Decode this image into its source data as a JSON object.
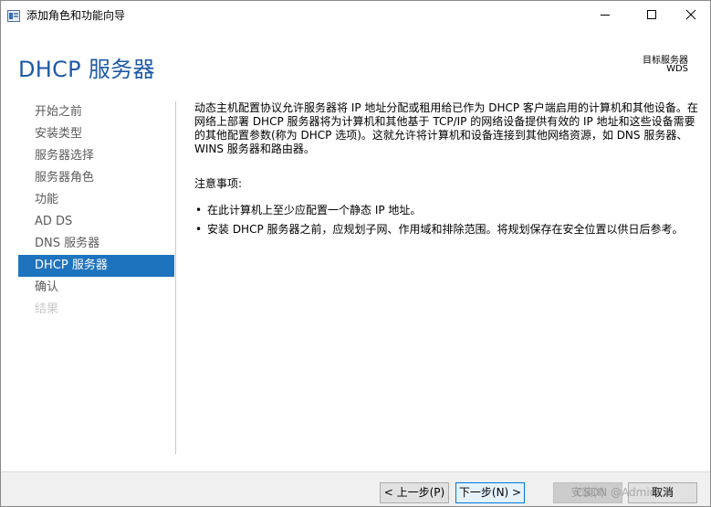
{
  "window": {
    "title": "添加角色和功能向导",
    "controls": {
      "minimize": "minimize-icon",
      "maximize": "maximize-icon",
      "close": "close-icon"
    }
  },
  "header": {
    "title": "DHCP 服务器",
    "target_label": "目标服务器",
    "target_value": "WDS"
  },
  "nav": {
    "items": [
      {
        "label": "开始之前",
        "state": "normal"
      },
      {
        "label": "安装类型",
        "state": "normal"
      },
      {
        "label": "服务器选择",
        "state": "normal"
      },
      {
        "label": "服务器角色",
        "state": "normal"
      },
      {
        "label": "功能",
        "state": "normal"
      },
      {
        "label": "AD DS",
        "state": "normal"
      },
      {
        "label": "DNS 服务器",
        "state": "normal"
      },
      {
        "label": "DHCP 服务器",
        "state": "active"
      },
      {
        "label": "确认",
        "state": "normal"
      },
      {
        "label": "结果",
        "state": "disabled"
      }
    ]
  },
  "content": {
    "description": "动态主机配置协议允许服务器将 IP 地址分配或租用给已作为 DHCP 客户端启用的计算机和其他设备。在网络上部署 DHCP 服务器将为计算机和其他基于 TCP/IP 的网络设备提供有效的 IP 地址和这些设备需要的其他配置参数(称为 DHCP 选项)。这就允许将计算机和设备连接到其他网络资源，如 DNS 服务器、WINS 服务器和路由器。",
    "notes_title": "注意事项:",
    "bullets": [
      "在此计算机上至少应配置一个静态 IP 地址。",
      "安装 DHCP 服务器之前，应规划子网、作用域和排除范围。将规划保存在安全位置以供日后参考。"
    ],
    "bullet_char": "•"
  },
  "footer": {
    "prev": "< 上一步(P)",
    "next": "下一步(N) >",
    "install": "安装(I)",
    "cancel": "取消"
  },
  "watermark": "CSDN @AdminCC",
  "colors": {
    "accent": "#1e73be",
    "title": "#1e5aa6"
  }
}
